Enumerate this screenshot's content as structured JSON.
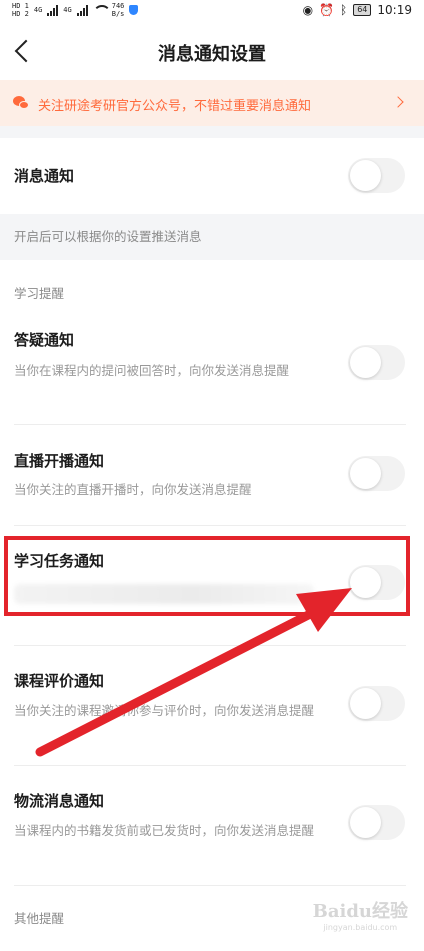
{
  "status_bar": {
    "hd1": "HD 1",
    "hd2": "HD 2",
    "net1": "4G",
    "net2": "4G",
    "speed": "746",
    "speed_unit": "B/s",
    "battery": "64",
    "time": "10:19"
  },
  "nav": {
    "title": "消息通知设置"
  },
  "banner": {
    "text": "关注研途考研官方公众号，不错过重要消息通知"
  },
  "main_toggle": {
    "title": "消息通知",
    "on": false
  },
  "main_hint": "开启后可以根据你的设置推送消息",
  "section_study": "学习提醒",
  "items": [
    {
      "title": "答疑通知",
      "desc": "当你在课程内的提问被回答时，向你发送消息提醒",
      "on": false
    },
    {
      "title": "直播开播通知",
      "desc": "当你关注的直播开播时，向你发送消息提醒",
      "on": false
    },
    {
      "title": "学习任务通知",
      "desc": "",
      "on": false
    },
    {
      "title": "课程评价通知",
      "desc": "当你关注的课程邀请你参与评价时，向你发送消息提醒",
      "on": false
    },
    {
      "title": "物流消息通知",
      "desc": "当课程内的书籍发货前或已发货时，向你发送消息提醒",
      "on": false
    }
  ],
  "section_other": "其他提醒",
  "watermark": {
    "main": "Baidu经验",
    "sub": "jingyan.baidu.com"
  },
  "colors": {
    "accent": "#ff6a3c",
    "banner_bg": "#fdeee6",
    "annotation_red": "#e3242b",
    "toggle_off": "#f2f2f2"
  }
}
